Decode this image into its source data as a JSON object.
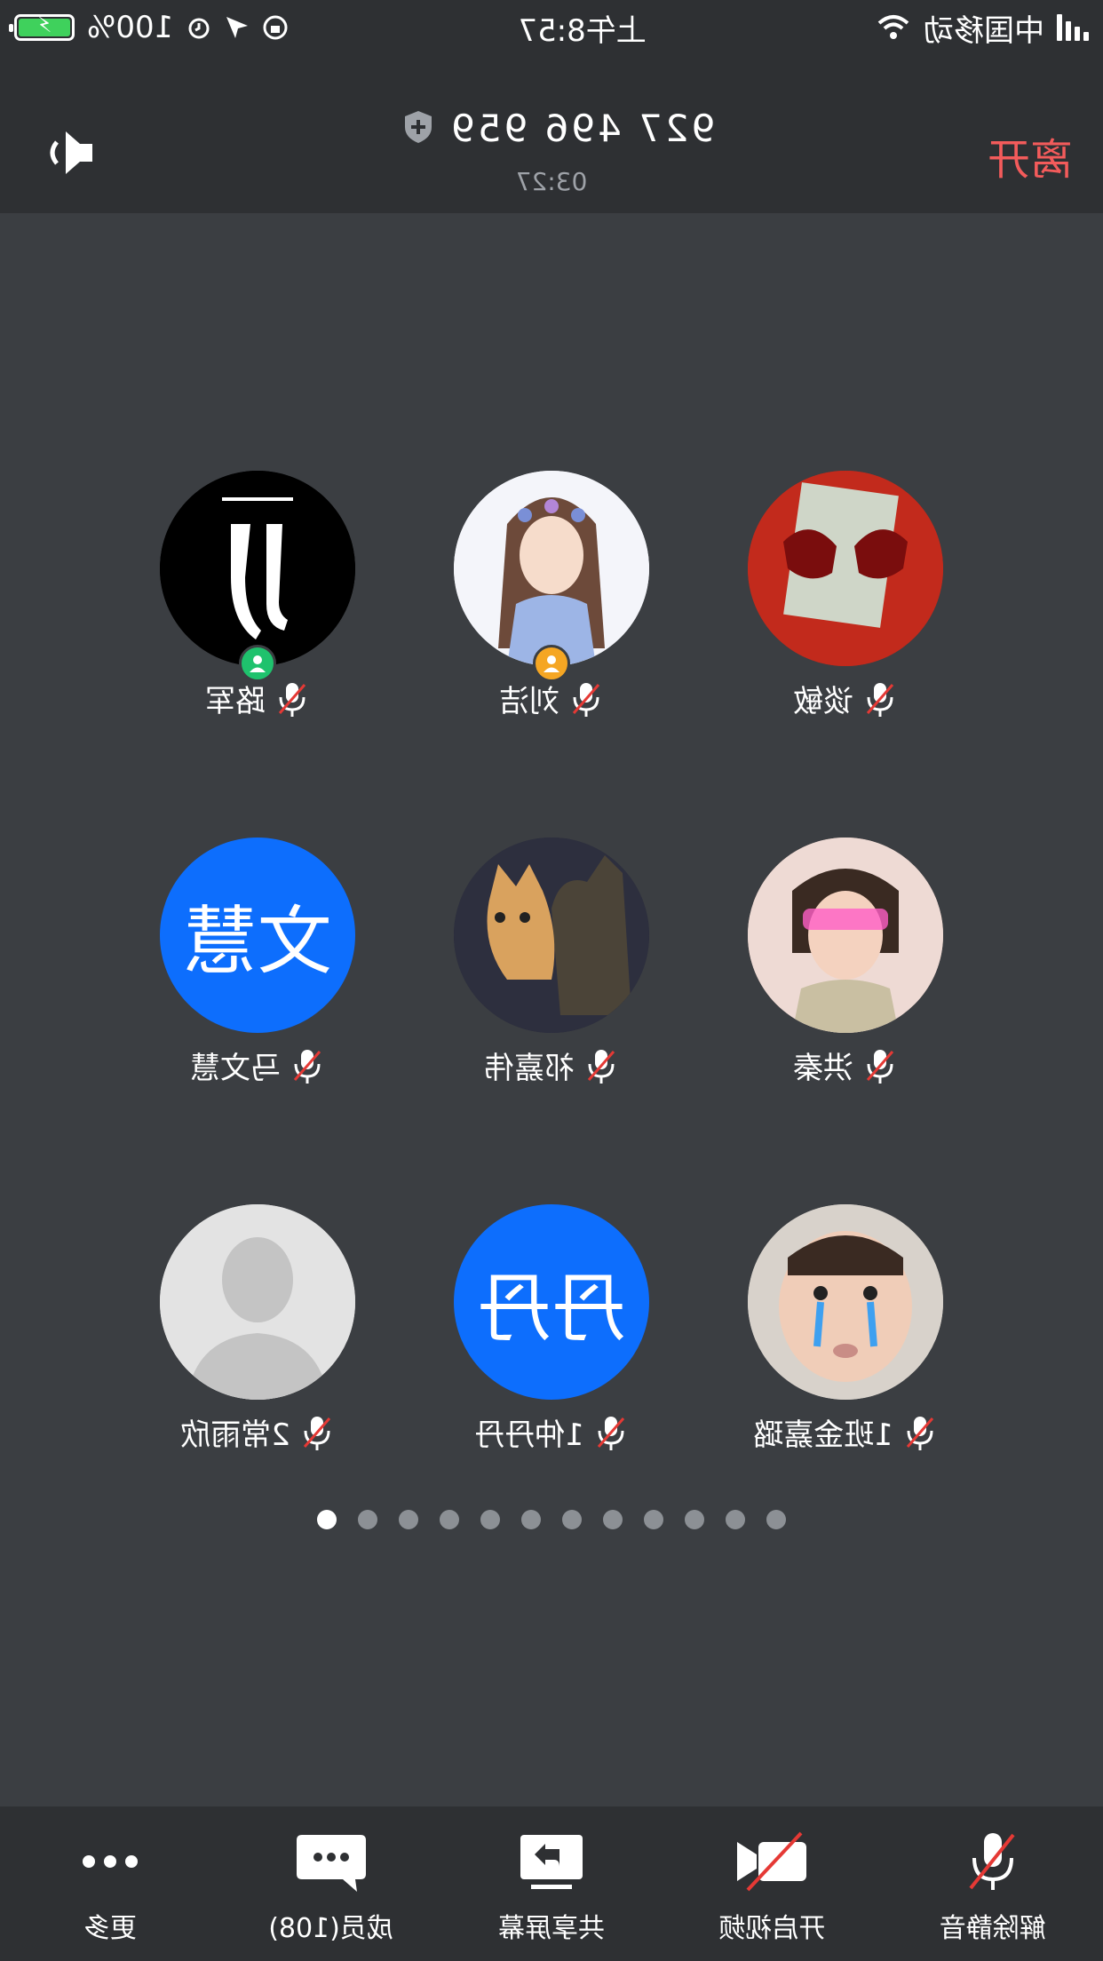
{
  "status_bar": {
    "carrier": "中国移动",
    "time": "上午8:57",
    "battery": "100%"
  },
  "header": {
    "leave_label": "离开",
    "meeting_id": "927 496 959",
    "timer": "03:27"
  },
  "participants": [
    {
      "name": "路军",
      "avatar_type": "image",
      "avatar_desc_icon": "juventus-logo-icon",
      "badge": "green",
      "muted": true
    },
    {
      "name": "刘洁",
      "avatar_type": "image",
      "avatar_desc_icon": "anime-girl-icon",
      "badge": "orange",
      "muted": true
    },
    {
      "name": "谈敏",
      "avatar_type": "image",
      "avatar_desc_icon": "red-glasses-photo-icon",
      "muted": true
    },
    {
      "name": "马文慧",
      "avatar_type": "text",
      "avatar_text": "文慧",
      "muted": true
    },
    {
      "name": "祁嘉伟",
      "avatar_type": "image",
      "avatar_desc_icon": "cat-photo-icon",
      "muted": true
    },
    {
      "name": "洪秦",
      "avatar_type": "image",
      "avatar_desc_icon": "girl-photo-icon",
      "muted": true
    },
    {
      "name": "2常雨欣",
      "avatar_type": "image",
      "avatar_desc_icon": "default-person-icon",
      "muted": true
    },
    {
      "name": "1仲丹丹",
      "avatar_type": "text",
      "avatar_text": "丹丹",
      "muted": true
    },
    {
      "name": "1班金嘉璐",
      "avatar_type": "image",
      "avatar_desc_icon": "crying-baby-photo-icon",
      "muted": true
    }
  ],
  "pager": {
    "pages": 12,
    "current": 12
  },
  "toolbar": {
    "unmute": "解除静音",
    "start_video": "开启视频",
    "share_screen": "共享屏幕",
    "members": "成员(108)",
    "more": "更多"
  },
  "colors": {
    "leave": "#f35b5b",
    "accent_blue": "#0d6efd",
    "badge_green": "#1fc26d",
    "badge_orange": "#f5a623",
    "mute_red": "#e53935"
  }
}
